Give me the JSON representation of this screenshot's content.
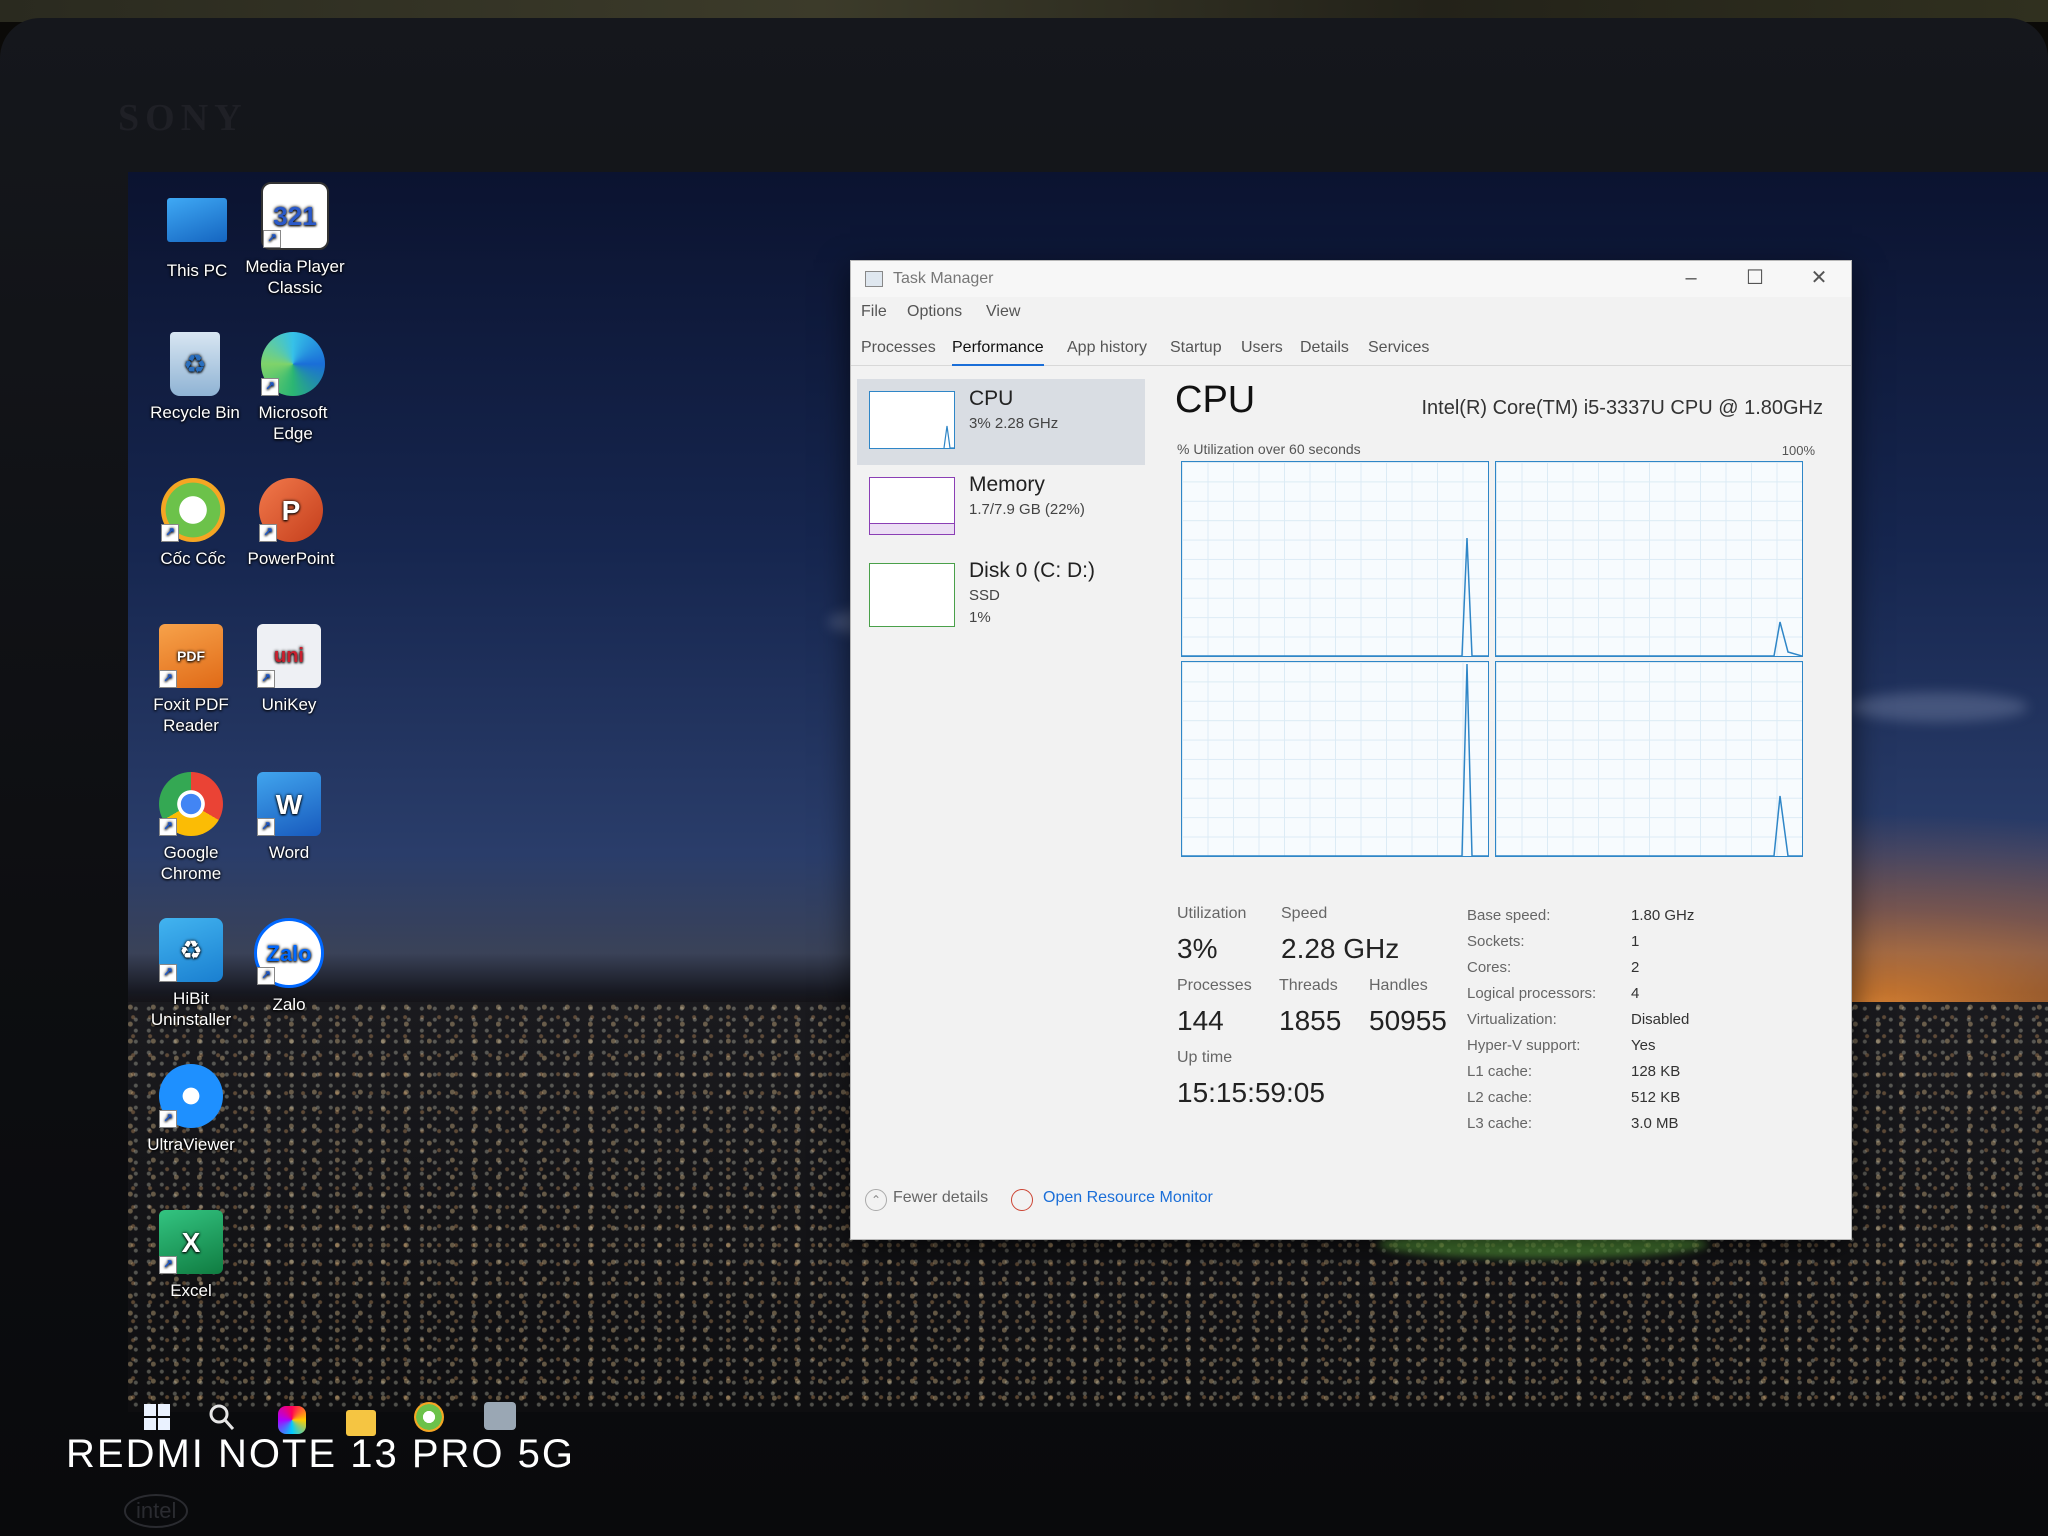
{
  "desktop": {
    "icons": [
      {
        "label": "This PC",
        "name": "this-pc-icon"
      },
      {
        "label": "Media Player Classic",
        "name": "media-player-classic-icon"
      },
      {
        "label": "Recycle Bin",
        "name": "recycle-bin-icon"
      },
      {
        "label": "Microsoft Edge",
        "name": "microsoft-edge-icon"
      },
      {
        "label": "Cốc Cốc",
        "name": "coc-coc-icon"
      },
      {
        "label": "PowerPoint",
        "name": "powerpoint-icon"
      },
      {
        "label": "Foxit PDF Reader",
        "name": "foxit-pdf-reader-icon"
      },
      {
        "label": "UniKey",
        "name": "unikey-icon"
      },
      {
        "label": "Google Chrome",
        "name": "google-chrome-icon"
      },
      {
        "label": "Word",
        "name": "word-icon"
      },
      {
        "label": "HiBit Uninstaller",
        "name": "hibit-uninstaller-icon"
      },
      {
        "label": "Zalo",
        "name": "zalo-icon"
      },
      {
        "label": "UltraViewer",
        "name": "ultraviewer-icon"
      },
      {
        "label": "Excel",
        "name": "excel-icon"
      }
    ],
    "icon_glyphs": {
      "media_player": "321",
      "powerpoint": "P",
      "foxit": "PDF",
      "unikey": "uni",
      "word": "W",
      "zalo": "Zalo",
      "excel": "X"
    }
  },
  "taskmanager": {
    "title": "Task Manager",
    "menu": [
      "File",
      "Options",
      "View"
    ],
    "tabs": [
      "Processes",
      "Performance",
      "App history",
      "Startup",
      "Users",
      "Details",
      "Services"
    ],
    "active_tab": "Performance",
    "sidebar": [
      {
        "name": "CPU",
        "sub1": "3%  2.28 GHz",
        "sub2": "",
        "sub3": "",
        "color": "#2f86c7",
        "selected": true
      },
      {
        "name": "Memory",
        "sub1": "1.7/7.9 GB (22%)",
        "sub2": "",
        "sub3": "",
        "color": "#8b3fb5",
        "selected": false
      },
      {
        "name": "Disk 0 (C: D:)",
        "sub1": "SSD",
        "sub2": "1%",
        "sub3": "",
        "color": "#4aa04a",
        "selected": false
      }
    ],
    "main": {
      "title": "CPU",
      "model": "Intel(R) Core(TM) i5-3337U CPU @ 1.80GHz",
      "util_label": "% Utilization over 60 seconds",
      "max_label": "100%"
    },
    "stats": {
      "utilization_label": "Utilization",
      "utilization": "3%",
      "speed_label": "Speed",
      "speed": "2.28 GHz",
      "processes_label": "Processes",
      "processes": "144",
      "threads_label": "Threads",
      "threads": "1855",
      "handles_label": "Handles",
      "handles": "50955",
      "uptime_label": "Up time",
      "uptime": "15:15:59:05"
    },
    "specs": [
      {
        "k": "Base speed:",
        "v": "1.80 GHz"
      },
      {
        "k": "Sockets:",
        "v": "1"
      },
      {
        "k": "Cores:",
        "v": "2"
      },
      {
        "k": "Logical processors:",
        "v": "4"
      },
      {
        "k": "Virtualization:",
        "v": "Disabled"
      },
      {
        "k": "Hyper-V support:",
        "v": "Yes"
      },
      {
        "k": "L1 cache:",
        "v": "128 KB"
      },
      {
        "k": "L2 cache:",
        "v": "512 KB"
      },
      {
        "k": "L3 cache:",
        "v": "3.0 MB"
      }
    ],
    "footer": {
      "fewer": "Fewer details",
      "resmon": "Open Resource Monitor"
    }
  },
  "photo": {
    "brand": "SONY",
    "watermark": "REDMI NOTE 13 PRO 5G",
    "intel": "intel"
  },
  "colors": {
    "accent": "#1a6ed8",
    "cpu_graph": "#2f86c7"
  }
}
